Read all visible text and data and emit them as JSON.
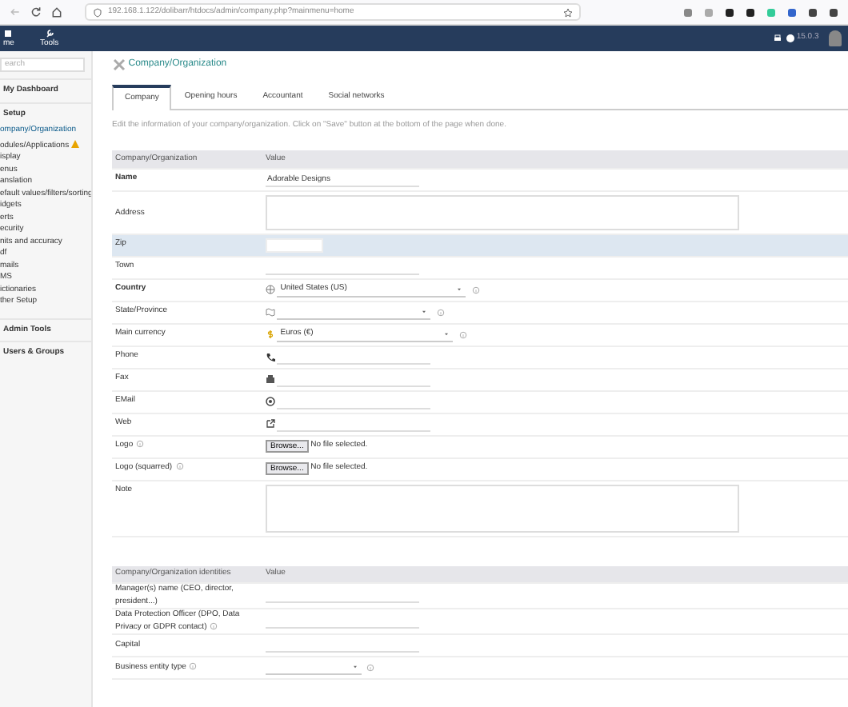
{
  "browser": {
    "url": "192.168.1.122/dolibarr/htdocs/admin/company.php?mainmenu=home"
  },
  "topbar": {
    "menus": [
      {
        "label": "me",
        "selected": false
      },
      {
        "label": "Tools",
        "selected": false
      }
    ],
    "version": "15.0.3"
  },
  "sidebar": {
    "search_placeholder": "earch",
    "sections": [
      {
        "title": "My Dashboard"
      },
      {
        "title": "Setup",
        "items": [
          {
            "label": "ompany/Organization",
            "selected": true,
            "warning": false
          },
          {
            "label": "odules/Applications",
            "selected": false,
            "warning": true
          },
          {
            "label": "isplay",
            "selected": false,
            "warning": false
          },
          {
            "label": "enus",
            "selected": false,
            "warning": false
          },
          {
            "label": "anslation",
            "selected": false,
            "warning": false
          },
          {
            "label": "efault values/filters/sorting",
            "selected": false,
            "warning": false
          },
          {
            "label": "idgets",
            "selected": false,
            "warning": false
          },
          {
            "label": "erts",
            "selected": false,
            "warning": false
          },
          {
            "label": "ecurity",
            "selected": false,
            "warning": false
          },
          {
            "label": "nits and accuracy",
            "selected": false,
            "warning": false
          },
          {
            "label": "df",
            "selected": false,
            "warning": false
          },
          {
            "label": "mails",
            "selected": false,
            "warning": false
          },
          {
            "label": "MS",
            "selected": false,
            "warning": false
          },
          {
            "label": "ictionaries",
            "selected": false,
            "warning": false
          },
          {
            "label": "ther Setup",
            "selected": false,
            "warning": false
          }
        ]
      },
      {
        "title": "Admin Tools"
      },
      {
        "title": "Users & Groups"
      }
    ]
  },
  "page": {
    "title": "Company/Organization",
    "tabs": [
      {
        "label": "Company",
        "selected": true
      },
      {
        "label": "Opening hours",
        "selected": false
      },
      {
        "label": "Accountant",
        "selected": false
      },
      {
        "label": "Social networks",
        "selected": false
      }
    ],
    "intro": "Edit the information of your company/organization. Click on \"Save\" button at the bottom of the page when done.",
    "tables": [
      {
        "columns": [
          "Company/Organization",
          "Value"
        ],
        "rows": [
          {
            "label": "Name",
            "kind": "text",
            "value": "Adorable Designs",
            "required": true,
            "info": false,
            "highlighted": false
          },
          {
            "label": "Address",
            "kind": "textarea",
            "required": false,
            "info": false,
            "highlighted": false
          },
          {
            "label": "Zip",
            "kind": "short",
            "required": false,
            "info": false,
            "highlighted": true
          },
          {
            "label": "Town",
            "kind": "text",
            "required": false,
            "info": false,
            "highlighted": false
          },
          {
            "label": "Country",
            "kind": "country",
            "value": "United States (US)",
            "required": true,
            "info": false,
            "highlighted": false
          },
          {
            "label": "State/Province",
            "kind": "state",
            "required": false,
            "info": false,
            "highlighted": false
          },
          {
            "label": "Main currency",
            "kind": "currency",
            "value": "Euros (€)",
            "required": false,
            "info": false,
            "highlighted": false
          },
          {
            "label": "Phone",
            "kind": "phone",
            "required": false,
            "info": false,
            "highlighted": false
          },
          {
            "label": "Fax",
            "kind": "fax",
            "required": false,
            "info": false,
            "highlighted": false
          },
          {
            "label": "EMail",
            "kind": "email",
            "required": false,
            "info": false,
            "highlighted": false
          },
          {
            "label": "Web",
            "kind": "web",
            "required": false,
            "info": false,
            "highlighted": false
          },
          {
            "label": "Logo",
            "kind": "file",
            "button": "Browse...",
            "file_status": "No file selected.",
            "required": false,
            "info": true,
            "highlighted": false
          },
          {
            "label": "Logo (squarred)",
            "kind": "file",
            "button": "Browse...",
            "file_status": "No file selected.",
            "required": false,
            "info": true,
            "highlighted": false
          },
          {
            "label": "Note",
            "kind": "note",
            "required": false,
            "info": false,
            "highlighted": false
          }
        ]
      },
      {
        "columns": [
          "Company/Organization identities",
          "Value"
        ],
        "rows": [
          {
            "label": "Manager(s) name (CEO, director, president...)",
            "kind": "text",
            "required": false,
            "info": false,
            "highlighted": false
          },
          {
            "label": "Data Protection Officer (DPO, Data Privacy or GDPR contact)",
            "kind": "text",
            "required": false,
            "info": true,
            "highlighted": false
          },
          {
            "label": "Capital",
            "kind": "text",
            "required": false,
            "info": false,
            "highlighted": false
          },
          {
            "label": "Business entity type",
            "kind": "select",
            "required": false,
            "info": true,
            "highlighted": false
          }
        ]
      }
    ]
  }
}
